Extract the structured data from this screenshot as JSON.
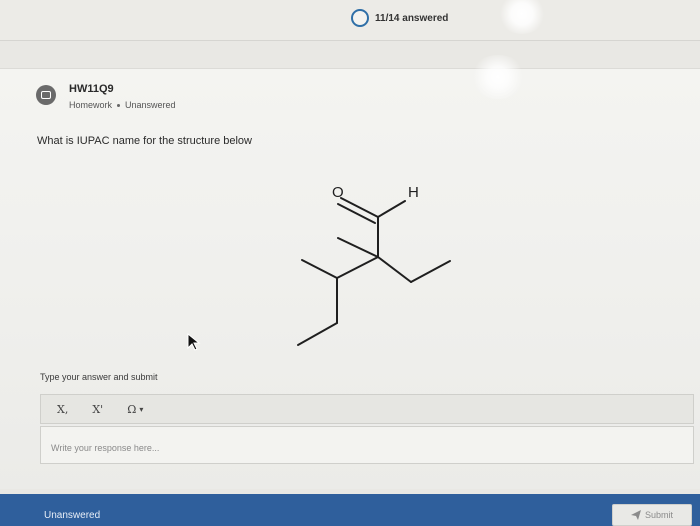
{
  "progress": {
    "text": "11/14 answered"
  },
  "question": {
    "title": "HW11Q9",
    "type": "Homework",
    "status": "Unanswered",
    "prompt": "What is IUPAC name for the structure below"
  },
  "structure": {
    "atom_o": "O",
    "atom_h": "H"
  },
  "answer": {
    "instruction": "Type your answer and submit",
    "toolbar": {
      "subscript": "X,",
      "superscript": "X'",
      "symbols": "Ω"
    },
    "placeholder": "Write your response here..."
  },
  "footer": {
    "status": "Unanswered",
    "submit_label": "Submit"
  },
  "colors": {
    "footer_bar": "#2f5f9c",
    "progress_ring": "#2f6fa7"
  }
}
